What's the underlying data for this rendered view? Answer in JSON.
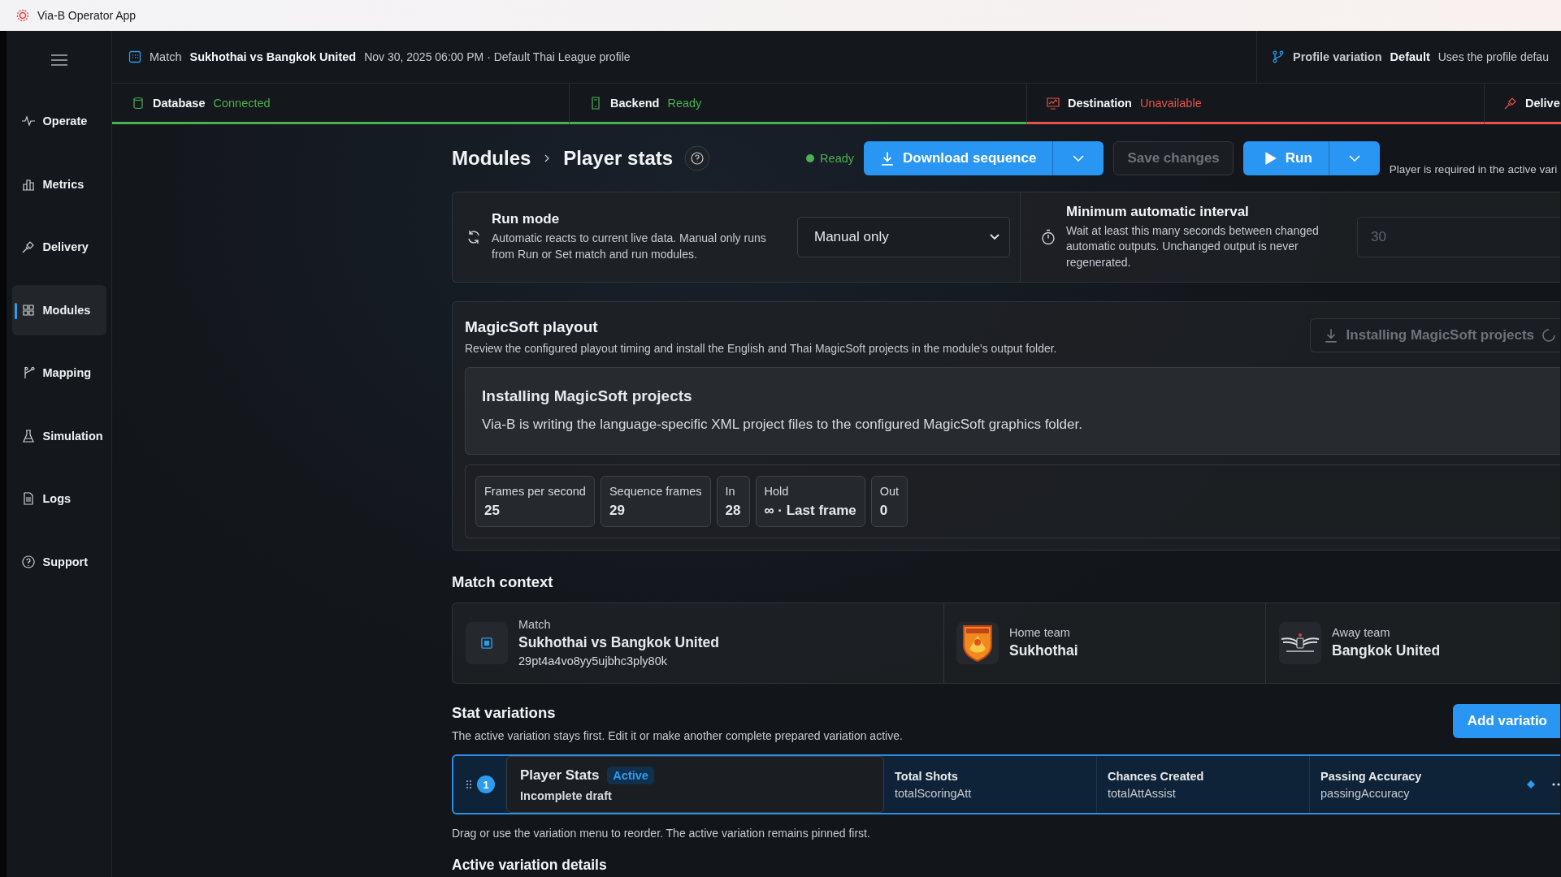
{
  "window": {
    "title": "Via-B Operator App"
  },
  "sidebar": {
    "items": [
      {
        "label": "Operate",
        "selected": false
      },
      {
        "label": "Metrics",
        "selected": false
      },
      {
        "label": "Delivery",
        "selected": false
      },
      {
        "label": "Modules",
        "selected": true
      },
      {
        "label": "Mapping",
        "selected": false
      },
      {
        "label": "Simulation",
        "selected": false
      },
      {
        "label": "Logs",
        "selected": false
      },
      {
        "label": "Support",
        "selected": false
      }
    ]
  },
  "match_bar": {
    "label": "Match",
    "match": "Sukhothai vs Bangkok United",
    "details": "Nov 30, 2025 06:00 PM · Default Thai League profile",
    "profile_label": "Profile variation",
    "profile_value": "Default",
    "profile_note": "Uses the profile defau"
  },
  "status_tabs": [
    {
      "label": "Database",
      "status": "Connected",
      "color": "#4caf50"
    },
    {
      "label": "Backend",
      "status": "Ready",
      "color": "#4caf50"
    },
    {
      "label": "Destination",
      "status": "Unavailable",
      "color": "#e5534b"
    },
    {
      "label": "Delive",
      "color": "#e5534b"
    }
  ],
  "breadcrumb": [
    "Modules",
    "Player stats"
  ],
  "toolbar": {
    "status": "Ready",
    "download": "Download sequence",
    "save": "Save changes",
    "save_disabled": true,
    "run": "Run",
    "note": "Player is required in the active vari"
  },
  "run_mode": {
    "title": "Run mode",
    "description": "Automatic reacts to current live data. Manual only runs from Run or Set match and run modules.",
    "select_value": "Manual only"
  },
  "interval": {
    "title": "Minimum automatic interval",
    "description": "Wait at least this many seconds between changed automatic outputs. Unchanged output is never regenerated.",
    "placeholder": "30"
  },
  "playout": {
    "title": "MagicSoft playout",
    "description": "Review the configured playout timing and install the English and Thai MagicSoft projects in the module's output folder.",
    "install_button": "Installing MagicSoft projects",
    "install_disabled": true,
    "notice": {
      "title": "Installing MagicSoft projects",
      "text": "Via-B is writing the language-specific XML project files to the configured MagicSoft graphics folder."
    },
    "stats": [
      {
        "label": "Frames per second",
        "value": "25"
      },
      {
        "label": "Sequence frames",
        "value": "29"
      },
      {
        "label": "In",
        "value": "28"
      },
      {
        "label": "Hold",
        "value": "∞ · Last frame"
      },
      {
        "label": "Out",
        "value": "0"
      }
    ]
  },
  "match_context": {
    "title": "Match context",
    "match": {
      "label": "Match",
      "name": "Sukhothai vs Bangkok United",
      "id": "29pt4a4vo8yy5ujbhc3ply80k"
    },
    "home": {
      "label": "Home team",
      "name": "Sukhothai"
    },
    "away": {
      "label": "Away team",
      "name": "Bangkok United"
    }
  },
  "stat_variations": {
    "title": "Stat variations",
    "description": "The active variation stays first. Edit it or make another complete prepared variation active.",
    "add_button": "Add variatio",
    "rows": [
      {
        "index": "1",
        "name": "Player Stats",
        "badge": "Active",
        "status": "Incomplete draft",
        "selected": true,
        "stats": [
          {
            "label": "Total Shots",
            "key": "totalScoringAtt"
          },
          {
            "label": "Chances Created",
            "key": "totalAttAssist"
          },
          {
            "label": "Passing Accuracy",
            "key": "passingAccuracy"
          }
        ]
      }
    ],
    "hint": "Drag or use the variation menu to reorder. The active variation remains pinned first.",
    "details_title": "Active variation details"
  }
}
